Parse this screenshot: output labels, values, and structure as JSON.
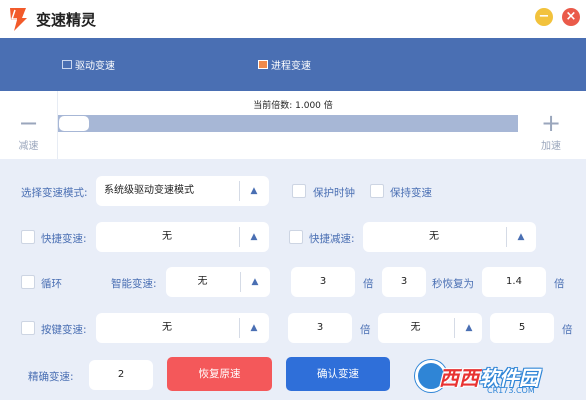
{
  "app": {
    "title": "变速精灵"
  },
  "nav": {
    "tab1": "驱动变速",
    "tab2": "进程变速"
  },
  "speed": {
    "current_label": "当前倍数: 1.000 倍",
    "decrease": "减速",
    "increase": "加速",
    "minus": "−",
    "plus": "+"
  },
  "form": {
    "mode_label": "选择变速模式:",
    "mode_value": "系统级驱动变速模式",
    "protect_clock": "保护时钟",
    "keep_speed": "保持变速",
    "quick_speed": "快捷变速:",
    "quick_speed_value": "无",
    "quick_slow": "快捷减速:",
    "quick_slow_value": "无",
    "loop": "循环",
    "smart_speed": "智能变速:",
    "smart_speed_value": "无",
    "loop_mult": "3",
    "loop_mult_unit": "倍",
    "loop_seconds": "3",
    "restore_label": "秒恢复为",
    "restore_value": "1.4",
    "restore_unit": "倍",
    "key_speed": "按键变速:",
    "key_speed_value": "无",
    "key_mult": "3",
    "key_mult_unit": "倍",
    "key_second": "无",
    "key_third": "5",
    "key_third_unit": "倍",
    "precise_label": "精确变速:",
    "precise_value": "2",
    "restore_button": "恢复原速",
    "confirm_button": "确认变速"
  },
  "watermark": {
    "brand_a": "西西",
    "brand_b": "软件园",
    "url": "CR173.COM"
  },
  "colors": {
    "accent": "#4a6fb3",
    "restore": "#f4585a",
    "confirm": "#2f6fd9",
    "panel": "#e9eef8"
  }
}
